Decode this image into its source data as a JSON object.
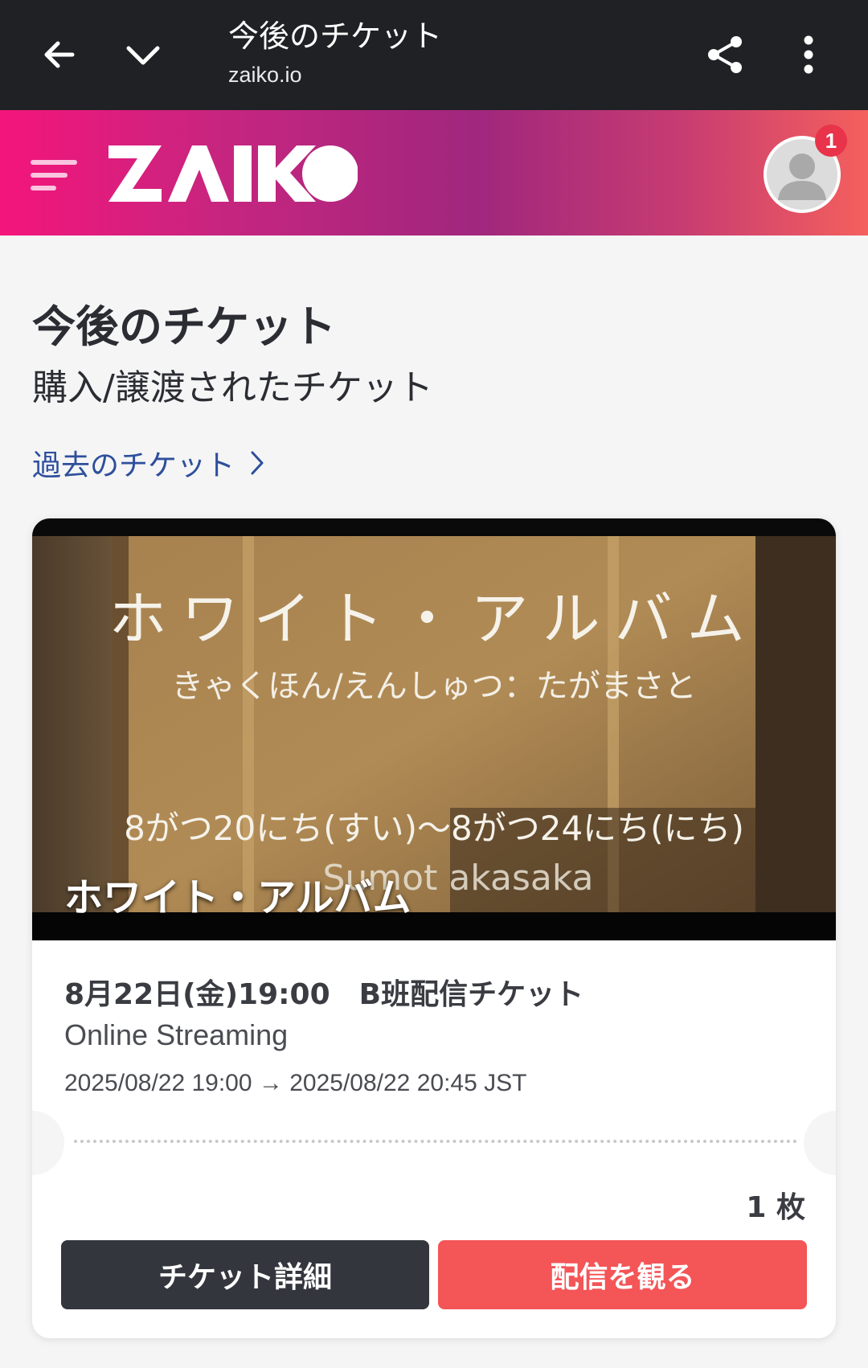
{
  "browser": {
    "title": "今後のチケット",
    "url": "zaiko.io"
  },
  "header": {
    "logo_text": "ZAIKO",
    "notification_count": "1",
    "colors": {
      "gradient_start": "#f4157b",
      "gradient_mid": "#a0277e",
      "gradient_end": "#f4605d"
    }
  },
  "page": {
    "title": "今後のチケット",
    "subtitle": "購入/譲渡されたチケット",
    "past_link": "過去のチケット"
  },
  "ticket": {
    "image_text_title": "ホワイト・アルバム",
    "image_text_credit": "きゃくほん/えんしゅつ：たがまさと",
    "image_text_dates": "8がつ20にち(すい)〜8がつ24にち(にち)",
    "image_text_venue": "Sumot akasaka",
    "event_title": "ホワイト・アルバム",
    "date_label": "8月22日(金)19:00",
    "ticket_type": "B班配信チケット",
    "venue": "Online Streaming",
    "datetime_range": "2025/08/22 19:00 → 2025/08/22 20:45 JST",
    "quantity": "1 枚",
    "detail_button": "チケット詳細",
    "watch_button": "配信を観る"
  }
}
